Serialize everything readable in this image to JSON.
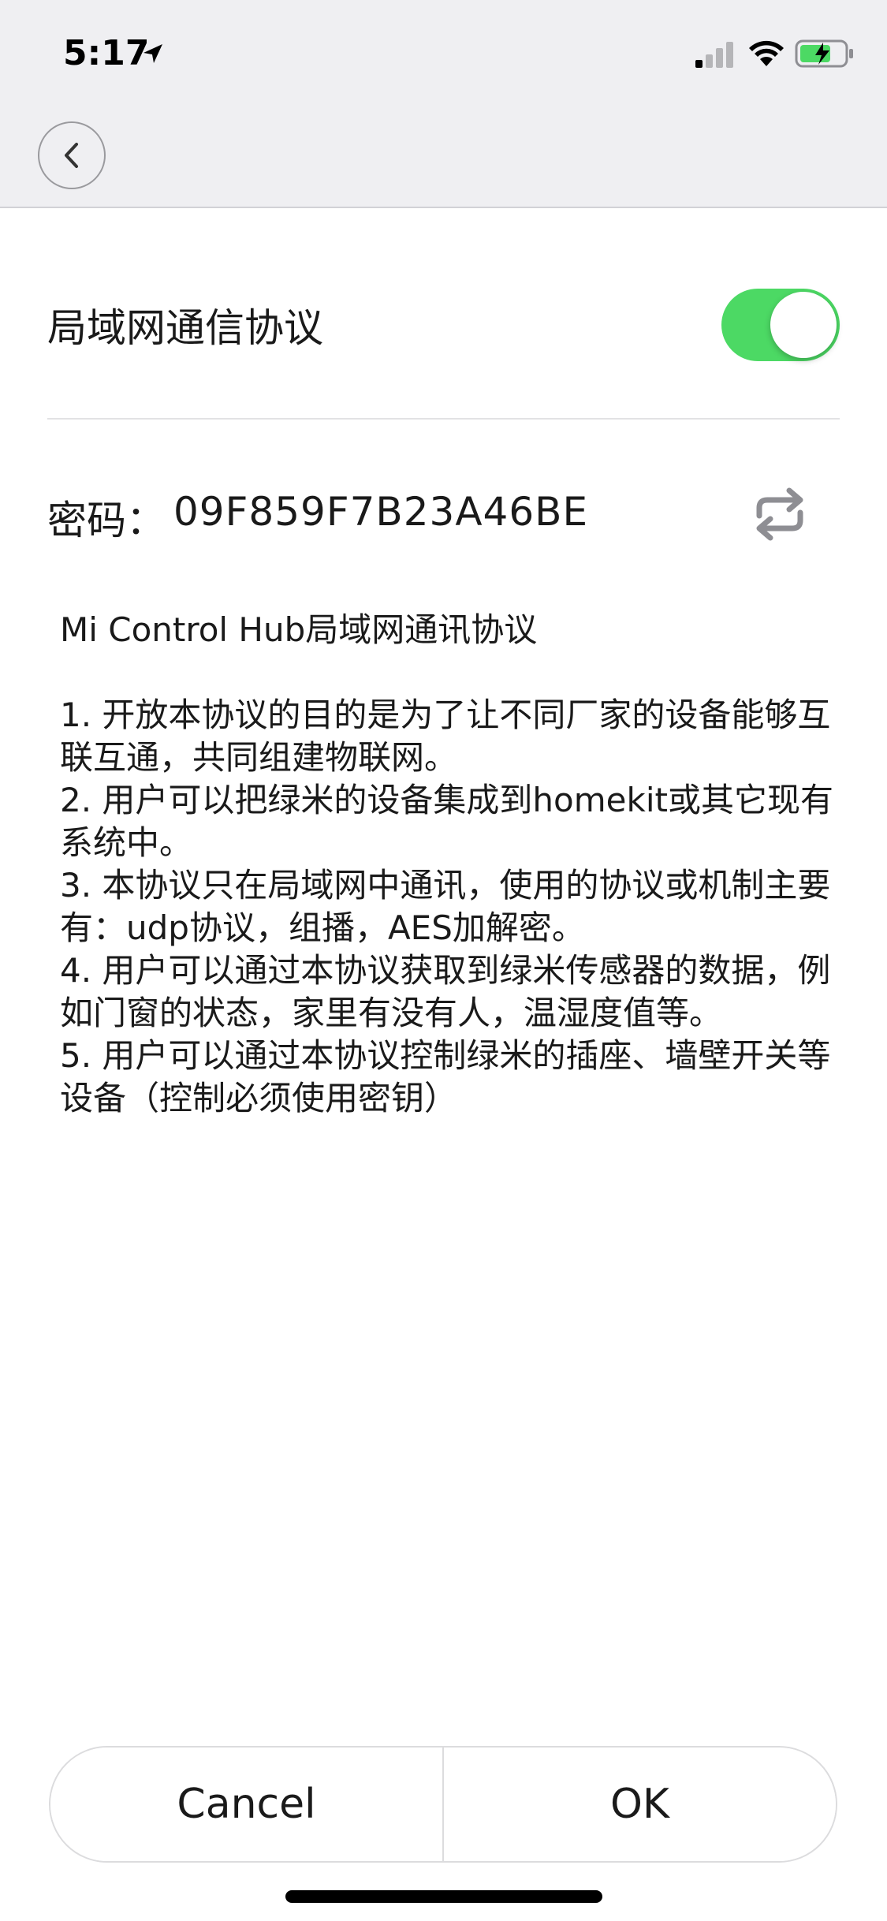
{
  "status_bar": {
    "time": "5:17",
    "location_icon": "location-arrow-icon",
    "signal_icon": "cellular-signal-icon",
    "wifi_icon": "wifi-icon",
    "battery_icon": "battery-charging-icon"
  },
  "nav": {
    "back_icon": "chevron-left-icon"
  },
  "settings": {
    "lan_protocol_label": "局域网通信协议",
    "lan_protocol_enabled": true,
    "toggle_color": "#4cd964",
    "password_label": "密码：",
    "password_value": "09F859F7B23A46BE",
    "refresh_icon": "refresh-icon"
  },
  "description": {
    "title": "Mi Control Hub局域网通讯协议",
    "items": [
      "1. 开放本协议的目的是为了让不同厂家的设备能够互联互通，共同组建物联网。",
      "2. 用户可以把绿米的设备集成到homekit或其它现有系统中。",
      "3. 本协议只在局域网中通讯，使用的协议或机制主要有：udp协议，组播，AES加解密。",
      "4. 用户可以通过本协议获取到绿米传感器的数据，例如门窗的状态，家里有没有人，温湿度值等。",
      "5. 用户可以通过本协议控制绿米的插座、墙壁开关等设备（控制必须使用密钥）"
    ]
  },
  "dialog": {
    "cancel_label": "Cancel",
    "ok_label": "OK"
  }
}
